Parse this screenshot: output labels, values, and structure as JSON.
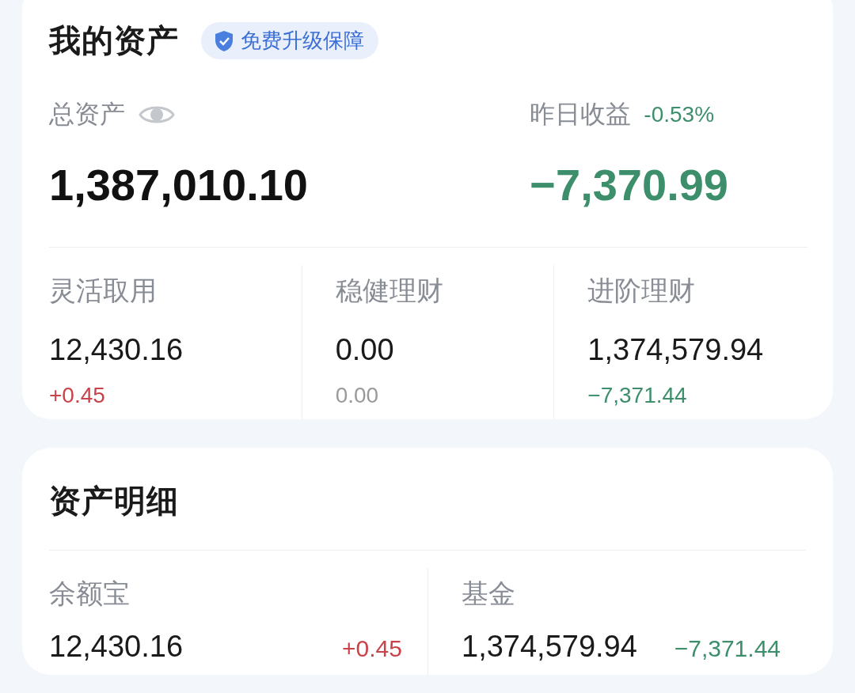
{
  "assets_card": {
    "title": "我的资产",
    "badge": "免费升级保障",
    "total_label": "总资产",
    "total_value": "1,387,010.10",
    "yesterday_label": "昨日收益",
    "yesterday_rate": "-0.53%",
    "yesterday_value": "−7,370.99",
    "categories": [
      {
        "label": "灵活取用",
        "value": "12,430.16",
        "change": "+0.45",
        "color": "#c8434a"
      },
      {
        "label": "稳健理财",
        "value": "0.00",
        "change": "0.00",
        "color": "#9a9a9a"
      },
      {
        "label": "进阶理财",
        "value": "1,374,579.94",
        "change": "−7,371.44",
        "color": "#3d8f6c"
      }
    ]
  },
  "details_card": {
    "title": "资产明细",
    "items": [
      {
        "label": "余额宝",
        "value": "12,430.16",
        "change": "+0.45",
        "color": "#c8434a"
      },
      {
        "label": "基金",
        "value": "1,374,579.94",
        "change": "−7,371.44",
        "color": "#3d8f6c"
      }
    ]
  }
}
